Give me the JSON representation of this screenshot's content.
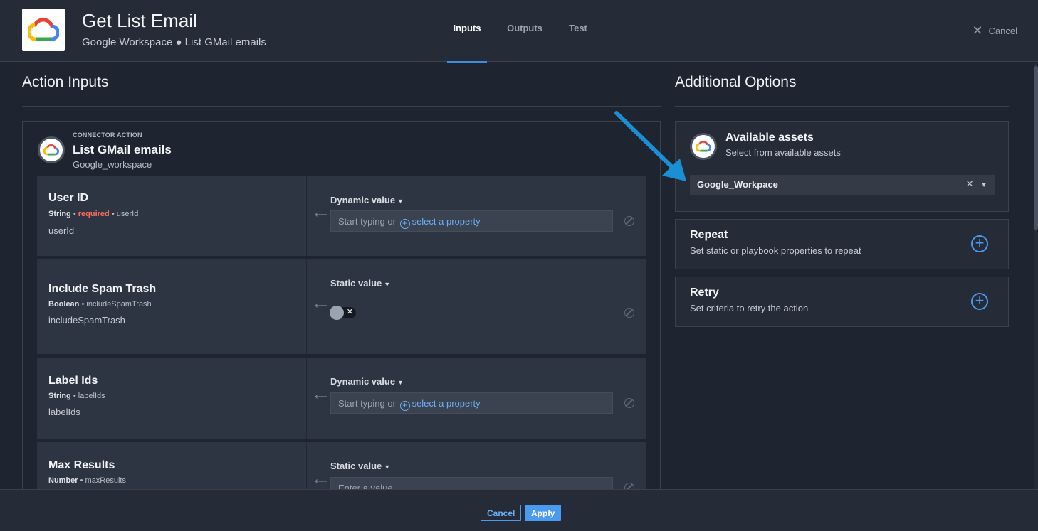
{
  "header": {
    "title": "Get List Email",
    "subtitle": "Google Workspace ● List GMail emails",
    "tabs": [
      "Inputs",
      "Outputs",
      "Test"
    ],
    "active_tab": "Inputs",
    "cancel_label": "Cancel"
  },
  "left": {
    "title": "Action Inputs",
    "connector": {
      "kind": "CONNECTOR ACTION",
      "name": "List GMail emails",
      "instance": "Google_workspace"
    },
    "fields": [
      {
        "name": "User ID",
        "type": "String",
        "required": "required",
        "key": "userId",
        "desc": "userId",
        "value_mode": "Dynamic value",
        "placeholder_prefix": "Start typing or",
        "placeholder_link": "select a property"
      },
      {
        "name": "Include Spam Trash",
        "type": "Boolean",
        "key": "includeSpamTrash",
        "desc": "includeSpamTrash",
        "value_mode": "Static value",
        "toggle_state": "off"
      },
      {
        "name": "Label Ids",
        "type": "String",
        "key": "labelIds",
        "desc": "labelIds",
        "value_mode": "Dynamic value",
        "placeholder_prefix": "Start typing or",
        "placeholder_link": "select a property"
      },
      {
        "name": "Max Results",
        "type": "Number",
        "key": "maxResults",
        "value_mode": "Static value",
        "placeholder": "Enter a value"
      }
    ]
  },
  "right": {
    "title": "Additional Options",
    "assets": {
      "title": "Available assets",
      "subtitle": "Select from available assets",
      "selected": "Google_Workpace"
    },
    "repeat": {
      "title": "Repeat",
      "subtitle": "Set static or playbook properties to repeat"
    },
    "retry": {
      "title": "Retry",
      "subtitle": "Set criteria to retry the action"
    }
  },
  "footer": {
    "cancel_label": "Cancel",
    "apply_label": "Apply"
  },
  "colors": {
    "accent": "#4a9af0",
    "required": "#ff6b5c",
    "callout_arrow": "#1a8fd6"
  }
}
